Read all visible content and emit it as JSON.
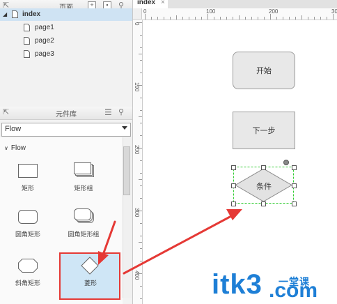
{
  "pages_panel": {
    "title": "页面",
    "root": "index",
    "pages": [
      "page1",
      "page2",
      "page3"
    ]
  },
  "library_panel": {
    "title": "元件库",
    "selected_library": "Flow",
    "section": "Flow",
    "widgets": [
      "矩形",
      "矩形组",
      "圆角矩形",
      "圆角矩形组",
      "斜角矩形",
      "菱形"
    ]
  },
  "canvas": {
    "tab_label": "index",
    "ruler_top": [
      "0",
      "100",
      "200",
      "30"
    ],
    "ruler_left": [
      "0",
      "100",
      "200",
      "300",
      "400"
    ],
    "shapes": {
      "start": "开始",
      "next": "下一步",
      "condition": "条件"
    }
  },
  "watermark": {
    "text": "itk3",
    "suffix": ".com",
    "cn": "一堂课"
  },
  "colors": {
    "selected_row": "#cfe3f3",
    "highlight": "#e53935",
    "selection_green": "#33cc33",
    "watermark_blue": "#1e7fd6"
  }
}
